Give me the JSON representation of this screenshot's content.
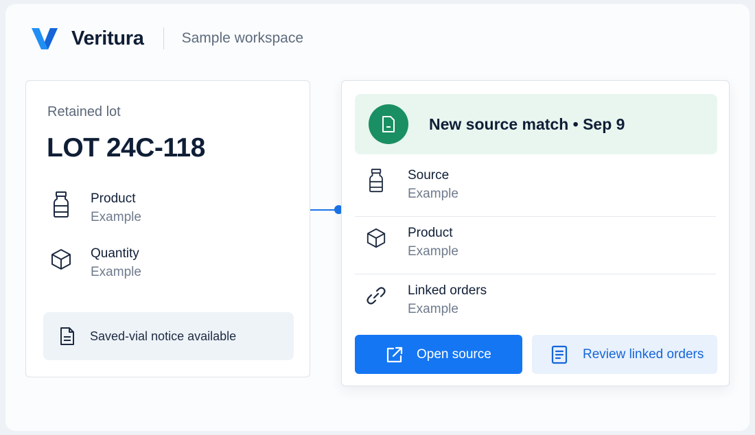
{
  "header": {
    "brand": "Veritura",
    "workspace": "Sample workspace"
  },
  "lot_card": {
    "caption": "Retained lot",
    "title": "LOT 24C-118",
    "fields": [
      {
        "icon": "vial-icon",
        "label": "Product",
        "value": "Example"
      },
      {
        "icon": "box-icon",
        "label": "Quantity",
        "value": "Example"
      }
    ],
    "notice": {
      "icon": "document-icon",
      "text": "Saved-vial notice available"
    }
  },
  "match_card": {
    "banner": {
      "icon": "document-icon",
      "title": "New source match • Sep 9"
    },
    "rows": [
      {
        "icon": "vial-icon",
        "label": "Source",
        "value": "Example"
      },
      {
        "icon": "box-icon",
        "label": "Product",
        "value": "Example"
      },
      {
        "icon": "link-icon",
        "label": "Linked orders",
        "value": "Example"
      }
    ],
    "primary_button": {
      "icon": "external-link-icon",
      "label": "Open source"
    },
    "secondary_button": {
      "icon": "list-document-icon",
      "label": "Review linked orders"
    }
  },
  "colors": {
    "accent": "#1476f2",
    "success": "#1a8f63",
    "banner_bg": "#e8f6ef",
    "text_primary": "#0f1e36",
    "text_muted": "#6e7a8c"
  }
}
